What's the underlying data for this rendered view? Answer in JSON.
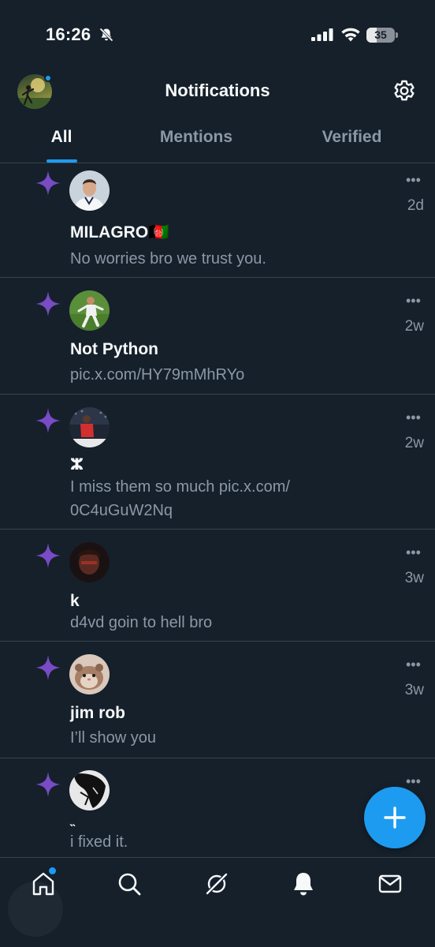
{
  "status_bar": {
    "time": "16:26",
    "battery_level": "35",
    "battery_fraction": 0.35
  },
  "header": {
    "title": "Notifications"
  },
  "tabs": [
    {
      "label": "All",
      "active": true
    },
    {
      "label": "Mentions",
      "active": false
    },
    {
      "label": "Verified",
      "active": false
    }
  ],
  "notifications": [
    {
      "name": "MILAGRO",
      "flag": "🇦🇫",
      "time": "2d",
      "text": "No worries bro we trust you.",
      "avatar_icon": "avatar-player-white-kit"
    },
    {
      "name": "Not Python",
      "time": "2w",
      "text": "pic.x.com/HY79mMhRYo",
      "avatar_icon": "avatar-player-on-pitch"
    },
    {
      "name": "ⵣ",
      "time": "2w",
      "text_lines": [
        "I miss them so much  pic.x.com/",
        "0C4uGuW2Nq"
      ],
      "avatar_icon": "avatar-player-red-kit"
    },
    {
      "name": "k",
      "time": "3w",
      "text": "d4vd goin to hell bro",
      "avatar_icon": "avatar-dark-portrait"
    },
    {
      "name": "jim rob",
      "time": "3w",
      "text": "I’ll show you",
      "avatar_icon": "avatar-hamster"
    },
    {
      "name": "˵",
      "time": "",
      "text": "i fixed it.",
      "avatar_icon": "avatar-manga-art"
    }
  ],
  "more_label": "•••",
  "fab": {
    "icon": "plus-icon"
  },
  "bottom_nav": [
    "home-icon",
    "search-icon",
    "grok-icon",
    "notifications-bell-icon",
    "messages-icon"
  ],
  "colors": {
    "background": "#15202b",
    "accent": "#1d9bf0",
    "sparkle": "#794bc4",
    "divider": "#38444d",
    "secondary_text": "#8b98a5"
  }
}
